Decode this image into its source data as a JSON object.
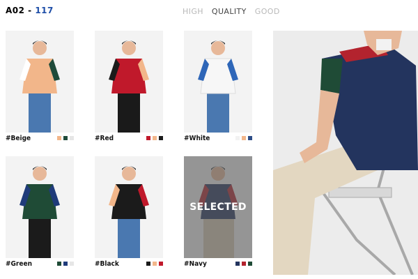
{
  "header": {
    "code": "A02 - ",
    "number": "117"
  },
  "tabs": [
    "HIGH",
    "QUALITY",
    "GOOD"
  ],
  "products": [
    {
      "label": "#Beige",
      "shirt": "#f2b68a",
      "sleeve_left": "#ffffff",
      "sleeve_right": "#1f4b3a",
      "pants": "#4a78b0",
      "swatches": [
        "#f2b68a",
        "#1f4b3a",
        "#e6e6e6"
      ]
    },
    {
      "label": "#Red",
      "shirt": "#c0192b",
      "sleeve_left": "#1b1b1b",
      "sleeve_right": "#f2b68a",
      "pants": "#1a1a1a",
      "swatches": [
        "#c0192b",
        "#f2b68a",
        "#1b1b1b"
      ]
    },
    {
      "label": "#White",
      "shirt": "#f7f7f7",
      "sleeve_left": "#2e66b8",
      "sleeve_right": "#2e66b8",
      "pants": "#4a78b0",
      "swatches": [
        "#f2f2f2",
        "#f2b68a",
        "#2e4d87"
      ]
    },
    {
      "label": "#Green",
      "shirt": "#1f4b36",
      "sleeve_left": "#1f3b7a",
      "sleeve_right": "#1f3b7a",
      "pants": "#1b1b1b",
      "swatches": [
        "#1f4b36",
        "#1f3b7a",
        "#e6e6e6"
      ]
    },
    {
      "label": "#Black",
      "shirt": "#1b1b1b",
      "sleeve_left": "#f2b68a",
      "sleeve_right": "#c0192b",
      "pants": "#4a78b0",
      "swatches": [
        "#1b1b1b",
        "#f2b68a",
        "#c0192b"
      ]
    },
    {
      "label": "#Navy",
      "shirt": "#23345e",
      "sleeve_left": "#b3232e",
      "sleeve_right": "#b3232e",
      "pants": "#d8cbb4",
      "swatches": [
        "#23345e",
        "#b3232e",
        "#1f4b36"
      ],
      "selected": true,
      "overlay_text": "SELECTED"
    }
  ],
  "hero": {
    "shirt": "#23345e",
    "shoulder": "#b3232e",
    "sleeve": "#1f4b36",
    "pants": "#e3d7c1",
    "skin": "#e7b899"
  }
}
